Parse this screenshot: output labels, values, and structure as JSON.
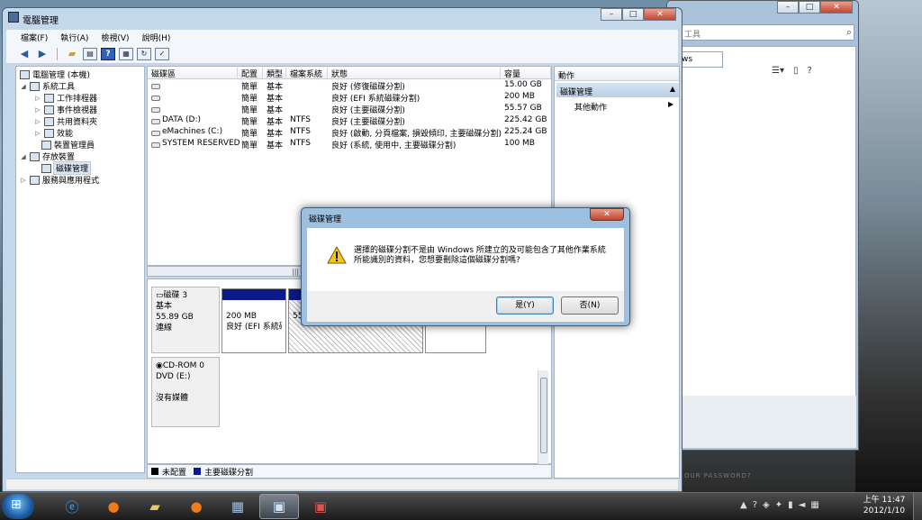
{
  "main_window": {
    "title": "電腦管理",
    "menu": [
      "檔案(F)",
      "執行(A)",
      "檢視(V)",
      "說明(H)"
    ]
  },
  "background_window": {
    "address_text": "工具",
    "search_text": "ws"
  },
  "tree": [
    {
      "label": "電腦管理 (本機)",
      "icon": "computer-management-icon"
    },
    {
      "label": "系統工具",
      "icon": "tools-icon"
    },
    {
      "label": "工作排程器",
      "icon": "clock-icon"
    },
    {
      "label": "事件檢視器",
      "icon": "event-viewer-icon"
    },
    {
      "label": "共用資料夾",
      "icon": "shared-folder-icon"
    },
    {
      "label": "效能",
      "icon": "performance-icon"
    },
    {
      "label": "裝置管理員",
      "icon": "device-manager-icon"
    },
    {
      "label": "存放裝置",
      "icon": "storage-icon"
    },
    {
      "label": "磁碟管理",
      "icon": "disk-management-icon"
    },
    {
      "label": "服務與應用程式",
      "icon": "services-icon"
    }
  ],
  "volumes": {
    "headers": [
      "磁碟區",
      "配置",
      "類型",
      "檔案系統",
      "狀態",
      "容量"
    ],
    "rows": [
      {
        "name": "",
        "layout": "簡單",
        "type": "基本",
        "fs": "",
        "status": "良好 (修復磁碟分割)",
        "capacity": "15.00 GB"
      },
      {
        "name": "",
        "layout": "簡單",
        "type": "基本",
        "fs": "",
        "status": "良好 (EFI 系統磁碟分割)",
        "capacity": "200 MB"
      },
      {
        "name": "",
        "layout": "簡單",
        "type": "基本",
        "fs": "",
        "status": "良好 (主要磁碟分割)",
        "capacity": "55.57 GB"
      },
      {
        "name": "DATA (D:)",
        "layout": "簡單",
        "type": "基本",
        "fs": "NTFS",
        "status": "良好 (主要磁碟分割)",
        "capacity": "225.42 GB"
      },
      {
        "name": "eMachines (C:)",
        "layout": "簡單",
        "type": "基本",
        "fs": "NTFS",
        "status": "良好 (啟動, 分頁檔案, 損毀傾印, 主要磁碟分割)",
        "capacity": "225.24 GB"
      },
      {
        "name": "SYSTEM RESERVED",
        "layout": "簡單",
        "type": "基本",
        "fs": "NTFS",
        "status": "良好 (系統, 使用中, 主要磁碟分割)",
        "capacity": "100 MB"
      }
    ]
  },
  "disks": [
    {
      "name": "磁碟 3",
      "type": "基本",
      "size": "55.89 GB",
      "state": "連線",
      "partitions": [
        {
          "size": "200 MB",
          "status": "良好 (EFI 系統磁"
        },
        {
          "size": "55.",
          "status": ""
        }
      ]
    },
    {
      "name": "CD-ROM 0",
      "type": "DVD (E:)",
      "size": "",
      "state": "沒有媒體",
      "partitions": []
    }
  ],
  "legend": [
    {
      "label": "未配置",
      "color": "#000000"
    },
    {
      "label": "主要磁碟分割",
      "color": "#0a1a8a"
    }
  ],
  "actions": {
    "header": "動作",
    "section": "磁碟管理",
    "item": "其他動作"
  },
  "dialog": {
    "title": "磁碟管理",
    "message_line1": "選擇的磁碟分割不是由 Windows 所建立的及可能包含了其他作業系統",
    "message_line2": "所能識別的資料，您想要刪除這個磁碟分割嗎?",
    "yes": "是(Y)",
    "no": "否(N)"
  },
  "background_text": {
    "password_hint": "OUR PASSWORD?"
  },
  "clock": {
    "time": "上午 11:47",
    "date": "2012/1/10"
  }
}
